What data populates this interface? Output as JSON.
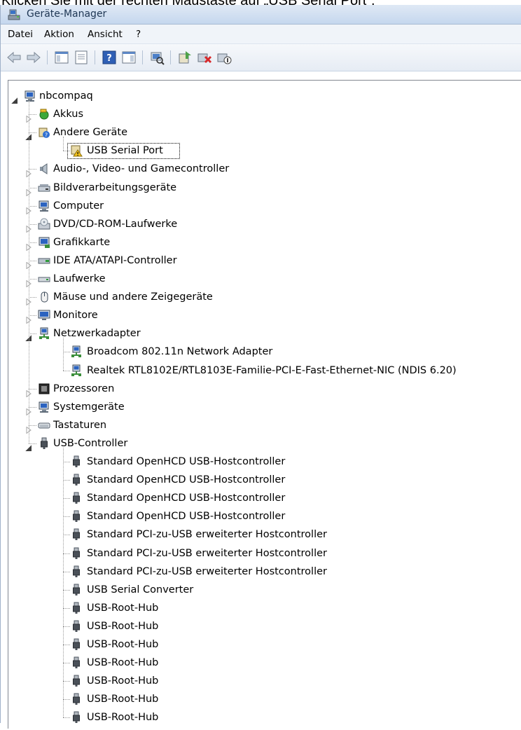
{
  "caption": "Klicken Sie mit der rechten Maustaste auf „USB Serial Port“.",
  "window": {
    "title": "Geräte-Manager",
    "title_icon": "device-manager-icon"
  },
  "menu": [
    "Datei",
    "Aktion",
    "Ansicht",
    "?"
  ],
  "toolbar": [
    {
      "icon": "back-arrow-icon"
    },
    {
      "icon": "forward-arrow-icon"
    },
    {
      "icon": "show-hide-console-tree-icon"
    },
    {
      "icon": "properties-icon"
    },
    {
      "icon": "help-icon"
    },
    {
      "icon": "action-pane-icon"
    },
    {
      "icon": "scan-hardware-icon"
    },
    {
      "icon": "update-driver-icon"
    },
    {
      "icon": "uninstall-device-icon"
    },
    {
      "icon": "disable-device-icon"
    }
  ],
  "tree": {
    "root": "nbcompaq",
    "items": [
      {
        "label": "Akkus",
        "level": 1,
        "state": "collapsed",
        "icon": "battery-icon"
      },
      {
        "label": "Andere Geräte",
        "level": 1,
        "state": "expanded",
        "icon": "unknown-device-icon"
      },
      {
        "label": "USB Serial Port",
        "level": 2,
        "state": "leaf",
        "icon": "warning-device-icon",
        "selected": true
      },
      {
        "label": "Audio-, Video- und Gamecontroller",
        "level": 1,
        "state": "collapsed",
        "icon": "speaker-icon"
      },
      {
        "label": "Bildverarbeitungsgeräte",
        "level": 1,
        "state": "collapsed",
        "icon": "scanner-icon"
      },
      {
        "label": "Computer",
        "level": 1,
        "state": "collapsed",
        "icon": "computer-icon"
      },
      {
        "label": "DVD/CD-ROM-Laufwerke",
        "level": 1,
        "state": "collapsed",
        "icon": "dvd-drive-icon"
      },
      {
        "label": "Grafikkarte",
        "level": 1,
        "state": "collapsed",
        "icon": "display-adapter-icon"
      },
      {
        "label": "IDE ATA/ATAPI-Controller",
        "level": 1,
        "state": "collapsed",
        "icon": "ide-controller-icon"
      },
      {
        "label": "Laufwerke",
        "level": 1,
        "state": "collapsed",
        "icon": "disk-drive-icon"
      },
      {
        "label": "Mäuse und andere Zeigegeräte",
        "level": 1,
        "state": "collapsed",
        "icon": "mouse-icon"
      },
      {
        "label": "Monitore",
        "level": 1,
        "state": "collapsed",
        "icon": "monitor-icon"
      },
      {
        "label": "Netzwerkadapter",
        "level": 1,
        "state": "expanded",
        "icon": "network-adapter-icon"
      },
      {
        "label": "Broadcom 802.11n Network Adapter",
        "level": 2,
        "state": "leaf",
        "icon": "network-adapter-icon"
      },
      {
        "label": "Realtek RTL8102E/RTL8103E-Familie-PCI-E-Fast-Ethernet-NIC (NDIS 6.20)",
        "level": 2,
        "state": "leaf",
        "icon": "network-adapter-icon"
      },
      {
        "label": "Prozessoren",
        "level": 1,
        "state": "collapsed",
        "icon": "processor-icon"
      },
      {
        "label": "Systemgeräte",
        "level": 1,
        "state": "collapsed",
        "icon": "computer-icon"
      },
      {
        "label": "Tastaturen",
        "level": 1,
        "state": "collapsed",
        "icon": "keyboard-icon"
      },
      {
        "label": "USB-Controller",
        "level": 1,
        "state": "expanded",
        "icon": "usb-plug-icon"
      },
      {
        "label": "Standard OpenHCD USB-Hostcontroller",
        "level": 2,
        "state": "leaf",
        "icon": "usb-plug-icon"
      },
      {
        "label": "Standard OpenHCD USB-Hostcontroller",
        "level": 2,
        "state": "leaf",
        "icon": "usb-plug-icon"
      },
      {
        "label": "Standard OpenHCD USB-Hostcontroller",
        "level": 2,
        "state": "leaf",
        "icon": "usb-plug-icon"
      },
      {
        "label": "Standard OpenHCD USB-Hostcontroller",
        "level": 2,
        "state": "leaf",
        "icon": "usb-plug-icon"
      },
      {
        "label": "Standard PCI-zu-USB erweiterter Hostcontroller",
        "level": 2,
        "state": "leaf",
        "icon": "usb-plug-icon"
      },
      {
        "label": "Standard PCI-zu-USB erweiterter Hostcontroller",
        "level": 2,
        "state": "leaf",
        "icon": "usb-plug-icon"
      },
      {
        "label": "Standard PCI-zu-USB erweiterter Hostcontroller",
        "level": 2,
        "state": "leaf",
        "icon": "usb-plug-icon"
      },
      {
        "label": "USB Serial Converter",
        "level": 2,
        "state": "leaf",
        "icon": "usb-plug-icon"
      },
      {
        "label": "USB-Root-Hub",
        "level": 2,
        "state": "leaf",
        "icon": "usb-plug-icon"
      },
      {
        "label": "USB-Root-Hub",
        "level": 2,
        "state": "leaf",
        "icon": "usb-plug-icon"
      },
      {
        "label": "USB-Root-Hub",
        "level": 2,
        "state": "leaf",
        "icon": "usb-plug-icon"
      },
      {
        "label": "USB-Root-Hub",
        "level": 2,
        "state": "leaf",
        "icon": "usb-plug-icon"
      },
      {
        "label": "USB-Root-Hub",
        "level": 2,
        "state": "leaf",
        "icon": "usb-plug-icon"
      },
      {
        "label": "USB-Root-Hub",
        "level": 2,
        "state": "leaf",
        "icon": "usb-plug-icon"
      },
      {
        "label": "USB-Root-Hub",
        "level": 2,
        "state": "leaf",
        "icon": "usb-plug-icon"
      }
    ]
  },
  "colors": {
    "selection_border": "#000000",
    "tree_line": "#9a9a9a",
    "titlebar": "#c5d7ee"
  }
}
